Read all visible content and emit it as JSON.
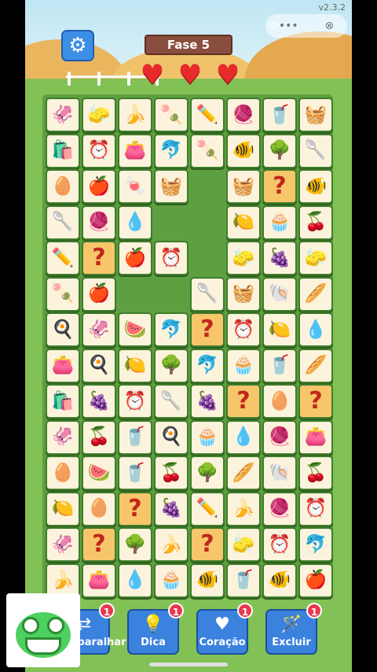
{
  "header": {
    "version": "v2.3.2",
    "level_title": "Fase 5",
    "lives": 3
  },
  "icons": {
    "squid": "🦑",
    "sponge": "🧽",
    "banana": "🍌",
    "popsicle": "🍡",
    "pencil": "✏️",
    "yarn": "🧶",
    "cup": "🥤",
    "basket": "🧺",
    "flour": "🛍️",
    "clock": "⏰",
    "purse": "👛",
    "dolphin": "🐬",
    "tree": "🌳",
    "spoon": "🥄",
    "egg": "🥚",
    "apple": "🍎",
    "candy": "🍬",
    "fish": "🐠",
    "drop": "💧",
    "lemon": "🍋",
    "cupcake": "🧁",
    "cherry": "🍒",
    "grape": "🍇",
    "shell": "🐚",
    "bread": "🥖",
    "pan": "🍳",
    "melon": "🍉",
    "question": "?"
  },
  "board": {
    "rows": [
      [
        "squid",
        "sponge",
        "banana",
        "popsicle",
        "pencil",
        "yarn",
        "cup",
        "basket"
      ],
      [
        "flour",
        "clock",
        "purse",
        "dolphin",
        "popsicle",
        "fish",
        "tree",
        "spoon"
      ],
      [
        "egg",
        "apple",
        "candy",
        "basket",
        null,
        "basket",
        "question",
        "fish"
      ],
      [
        "spoon",
        "yarn",
        "drop",
        null,
        null,
        "lemon",
        "cupcake",
        "cherry"
      ],
      [
        "pencil",
        "question",
        "apple",
        "clock",
        null,
        "sponge",
        "grape",
        "sponge"
      ],
      [
        "popsicle",
        "apple",
        null,
        null,
        "spoon",
        "basket",
        "shell",
        "bread"
      ],
      [
        "pan",
        "squid",
        "melon",
        "dolphin",
        "question",
        "clock",
        "lemon",
        "drop"
      ],
      [
        "purse",
        "pan",
        "lemon",
        "tree",
        "dolphin",
        "cupcake",
        "cup",
        "bread"
      ],
      [
        "flour",
        "grape",
        "clock",
        "spoon",
        "grape",
        "question",
        "egg",
        "question"
      ],
      [
        "squid",
        "cherry",
        "cup",
        "pan",
        "cupcake",
        "drop",
        "yarn",
        "purse"
      ],
      [
        "egg",
        "melon",
        "cup",
        "cherry",
        "tree",
        "bread",
        "shell",
        "cherry"
      ],
      [
        "lemon",
        "egg",
        "question",
        "grape",
        "pencil",
        "banana",
        "yarn",
        "clock"
      ],
      [
        "squid",
        "question",
        "tree",
        "banana",
        "question",
        "sponge",
        "clock",
        "dolphin"
      ],
      [
        "banana",
        "purse",
        "drop",
        "cupcake",
        "fish",
        "cup",
        "fish",
        "apple"
      ]
    ]
  },
  "powerups": [
    {
      "label": "Embaralhar",
      "icon": "⇄",
      "count": "1"
    },
    {
      "label": "Dica",
      "icon": "💡",
      "count": "1"
    },
    {
      "label": "Coração",
      "icon": "♥",
      "count": "1"
    },
    {
      "label": "Excluir",
      "icon": "🪄",
      "count": "1"
    }
  ]
}
